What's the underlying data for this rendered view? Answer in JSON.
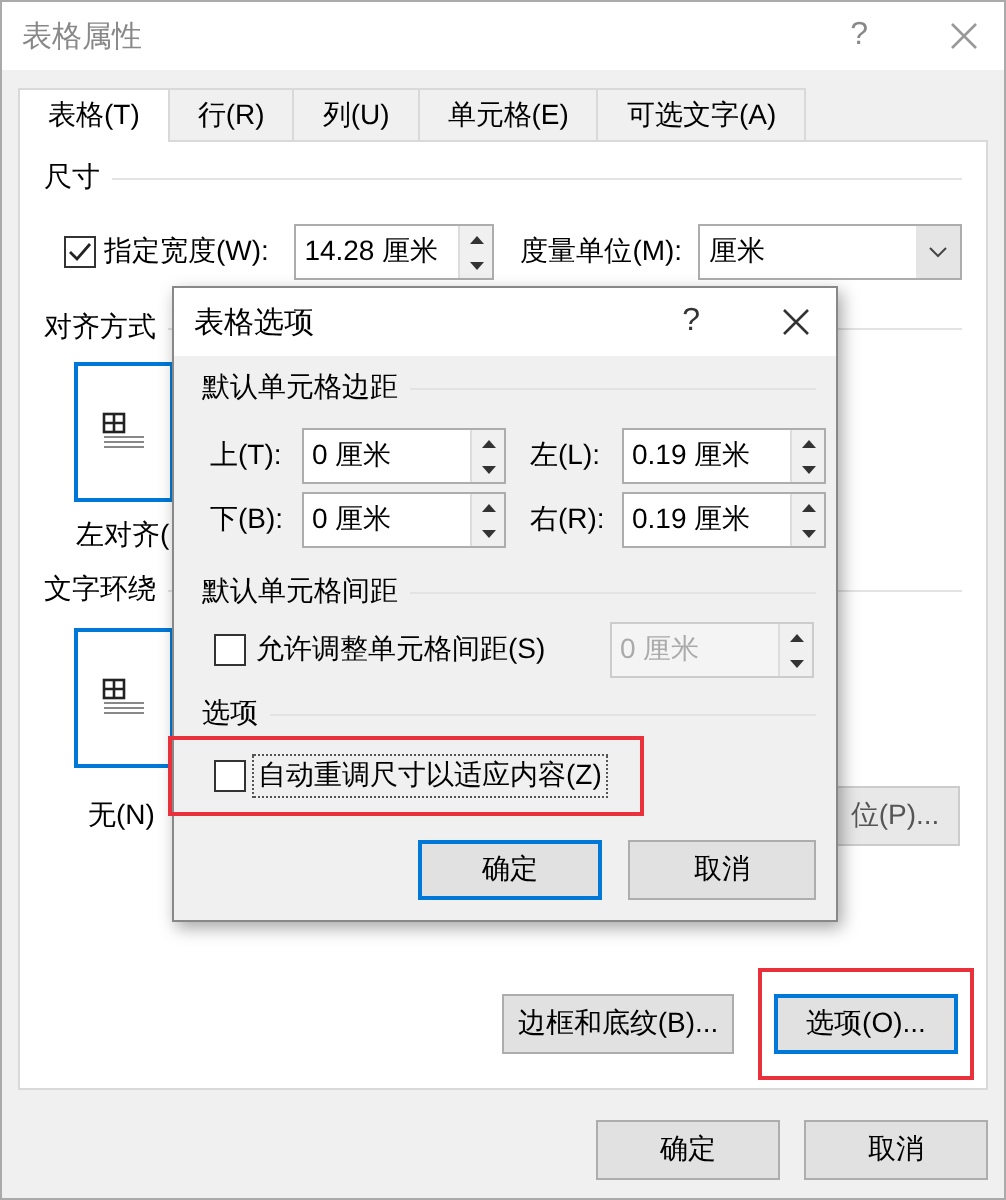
{
  "window": {
    "title": "表格属性",
    "help": "?"
  },
  "tabs": [
    {
      "label": "表格(T)",
      "selected": true
    },
    {
      "label": "行(R)",
      "selected": false
    },
    {
      "label": "列(U)",
      "selected": false
    },
    {
      "label": "单元格(E)",
      "selected": false
    },
    {
      "label": "可选文字(A)",
      "selected": false
    }
  ],
  "size_section": {
    "heading": "尺寸",
    "width_checkbox": {
      "label": "指定宽度(W):",
      "checked": true
    },
    "width_value": "14.28 厘米",
    "unit_label": "度量单位(M):",
    "unit_value": "厘米"
  },
  "alignment": {
    "heading": "对齐方式",
    "option": {
      "label": "左对齐(",
      "selected": true
    }
  },
  "wrapping": {
    "heading": "文字环绕",
    "option": {
      "label": "无(N)",
      "selected": true
    },
    "position_button": "位(P)..."
  },
  "panel_buttons": [
    {
      "label": "边框和底纹(B)...",
      "focused": false
    },
    {
      "label": "选项(O)...",
      "focused": true
    }
  ],
  "footer_buttons": [
    "确定",
    "取消"
  ],
  "options_dialog": {
    "title": "表格选项",
    "help": "?",
    "margins_heading": "默认单元格边距",
    "margins": [
      {
        "label": "上(T):",
        "value": "0 厘米"
      },
      {
        "label": "左(L):",
        "value": "0.19 厘米"
      },
      {
        "label": "下(B):",
        "value": "0 厘米"
      },
      {
        "label": "右(R):",
        "value": "0.19 厘米"
      }
    ],
    "spacing_heading": "默认单元格间距",
    "spacing_checkbox": {
      "label": "允许调整单元格间距(S)",
      "checked": false
    },
    "spacing_value": "0 厘米",
    "options_heading": "选项",
    "autofit_checkbox": {
      "label": "自动重调尺寸以适应内容(Z)",
      "checked": false
    },
    "buttons": [
      {
        "label": "确定",
        "focused": true
      },
      {
        "label": "取消",
        "focused": false
      }
    ]
  }
}
